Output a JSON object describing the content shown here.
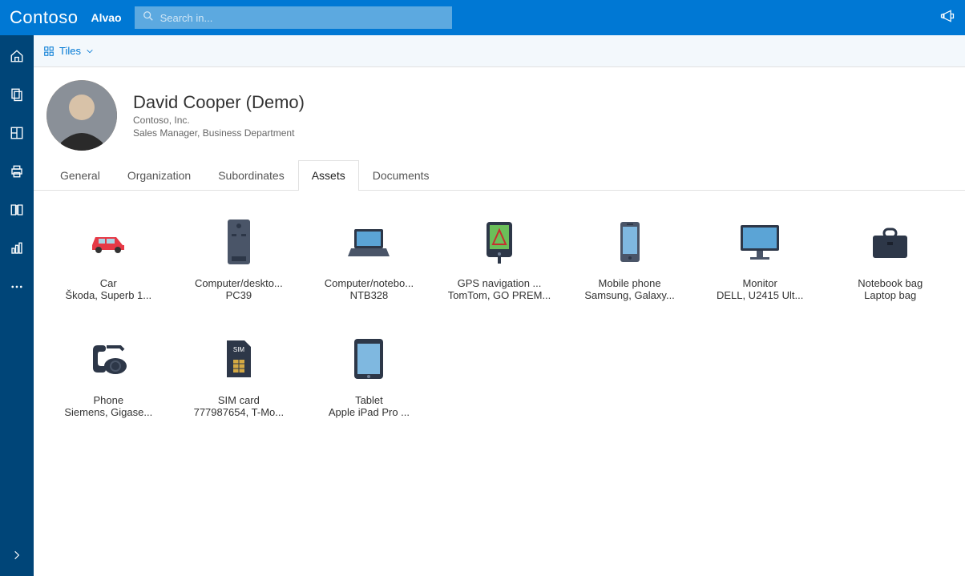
{
  "topbar": {
    "brand": "Contoso",
    "app": "Alvao",
    "search_placeholder": "Search in..."
  },
  "toolbar": {
    "tiles_label": "Tiles"
  },
  "profile": {
    "name": "David Cooper (Demo)",
    "company": "Contoso, Inc.",
    "role": "Sales Manager, Business Department"
  },
  "tabs": [
    {
      "label": "General"
    },
    {
      "label": "Organization"
    },
    {
      "label": "Subordinates"
    },
    {
      "label": "Assets",
      "active": true
    },
    {
      "label": "Documents"
    }
  ],
  "assets": [
    {
      "icon": "car",
      "title": "Car",
      "sub": "Škoda, Superb 1..."
    },
    {
      "icon": "desktop",
      "title": "Computer/deskto...",
      "sub": "PC39"
    },
    {
      "icon": "laptop",
      "title": "Computer/notebo...",
      "sub": "NTB328"
    },
    {
      "icon": "gps",
      "title": "GPS navigation ...",
      "sub": "TomTom, GO PREM..."
    },
    {
      "icon": "mobile",
      "title": "Mobile phone",
      "sub": "Samsung, Galaxy..."
    },
    {
      "icon": "monitor",
      "title": "Monitor",
      "sub": "DELL, U2415 Ult..."
    },
    {
      "icon": "bag",
      "title": "Notebook bag",
      "sub": "Laptop bag"
    },
    {
      "icon": "phone",
      "title": "Phone",
      "sub": "Siemens, Gigase..."
    },
    {
      "icon": "sim",
      "title": "SIM card",
      "sub": "777987654, T-Mo..."
    },
    {
      "icon": "tablet",
      "title": "Tablet",
      "sub": "Apple iPad Pro ..."
    }
  ]
}
